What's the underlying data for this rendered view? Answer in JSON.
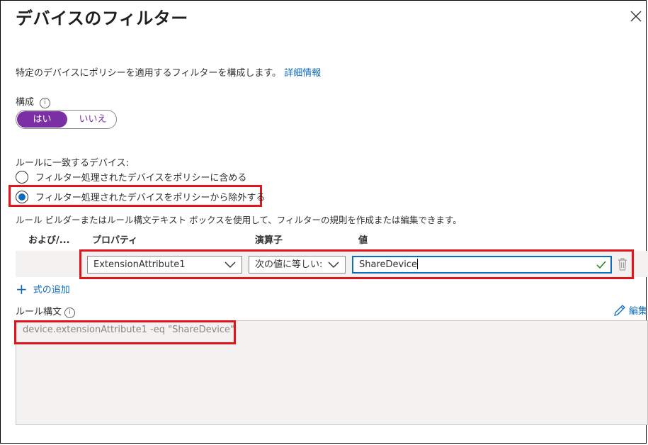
{
  "panel": {
    "title": "デバイスのフィルター",
    "description": "特定のデバイスにポリシーを適用するフィルターを構成します。",
    "learn_more": "詳細情報"
  },
  "configure": {
    "label": "構成",
    "info": "i",
    "yes": "はい",
    "no": "いいえ",
    "selected": "はい"
  },
  "match": {
    "label": "ルールに一致するデバイス:",
    "options": [
      "フィルター処理されたデバイスをポリシーに含める",
      "フィルター処理されたデバイスをポリシーから除外する"
    ],
    "selected_index": 1
  },
  "builder": {
    "description": "ルール ビルダーまたはルール構文テキスト ボックスを使用して、フィルターの規則を作成または編集できます。",
    "headers": [
      "および/...",
      "プロパティ",
      "演算子",
      "値"
    ],
    "row": {
      "property": "ExtensionAttribute1",
      "operator": "次の値に等しい:",
      "value": "ShareDevice"
    },
    "add_expression": "式の追加"
  },
  "rule_syntax": {
    "label": "ルール構文",
    "info": "i",
    "edit": "編集",
    "text": "device.extensionAttribute1 -eq \"ShareDevice\""
  },
  "colors": {
    "accent": "#7b2fa5",
    "link": "#0f6cbd",
    "highlight": "#e0141b"
  }
}
